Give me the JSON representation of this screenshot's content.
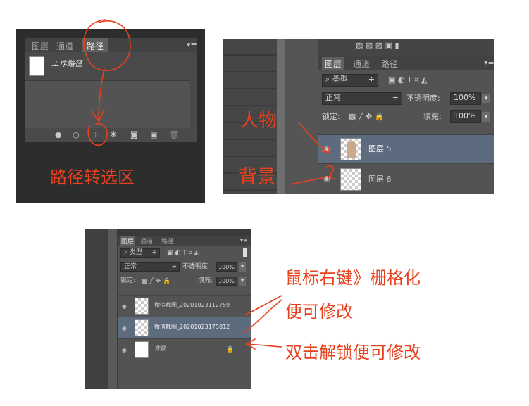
{
  "panel1": {
    "tabs": [
      "图层",
      "通道",
      "路径"
    ],
    "active_tab": "路径",
    "path_item": "工作路径",
    "caption": "路径转选区",
    "bottom_icons": [
      "fill-path-icon",
      "stroke-path-icon",
      "load-as-selection-icon",
      "make-work-path-icon",
      "add-mask-icon",
      "new-path-icon",
      "delete-icon"
    ]
  },
  "panel2": {
    "tabs": [
      "图层",
      "通道",
      "路径"
    ],
    "active_tab": "图层",
    "kind_filter": "类型",
    "blend_mode": "正常",
    "opacity_label": "不透明度:",
    "opacity_value": "100%",
    "lock_label": "锁定:",
    "fill_label": "填充:",
    "fill_value": "100%",
    "layers": [
      {
        "name": "图层 5",
        "selected": true
      },
      {
        "name": "图层 6",
        "selected": false
      }
    ],
    "anno_person": "人物",
    "anno_background": "背景"
  },
  "panel3": {
    "tabs": [
      "图层",
      "通道",
      "路径"
    ],
    "active_tab": "图层",
    "kind_filter": "类型",
    "blend_mode": "正常",
    "opacity_label": "不透明度:",
    "opacity_value": "100%",
    "lock_label": "锁定:",
    "fill_label": "填充:",
    "fill_value": "100%",
    "layers": [
      {
        "name": "微信截图_20201023112759",
        "selected": false
      },
      {
        "name": "微信截图_20201023175812",
        "selected": true
      },
      {
        "name": "背景",
        "selected": false
      }
    ],
    "anno_line1": "鼠标右键》栅格化",
    "anno_line2": "便可修改",
    "anno_line3": "双击解锁便可修改"
  },
  "colors": {
    "annotation": "#e8411e",
    "panel_bg": "#535353",
    "selected_row": "#5d6b7e"
  }
}
